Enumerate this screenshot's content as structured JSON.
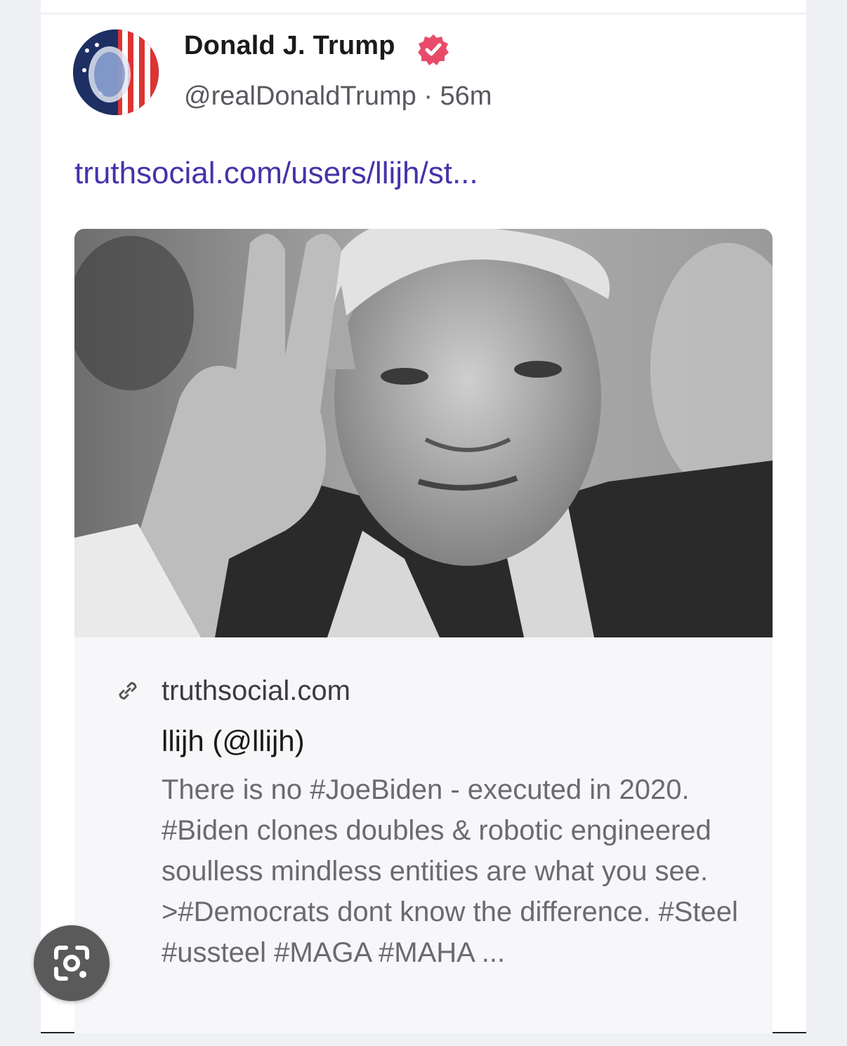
{
  "post": {
    "author_name": "Donald J. Trump",
    "handle": "@realDonaldTrump",
    "separator": "·",
    "time_ago": "56m",
    "link_text": "truthsocial.com/users/llijh/st..."
  },
  "preview": {
    "domain": "truthsocial.com",
    "title": "llijh (@llijh)",
    "description": "There is no #JoeBiden - executed in 2020. #Biden clones doubles & robotic engineered soulless mindless entities are what you see. >#Democrats dont know the difference. #Steel #ussteel #MAGA #MAHA ..."
  },
  "icons": {
    "verified": "verified-badge-icon",
    "link": "link-icon",
    "lens": "visual-search-icon"
  },
  "colors": {
    "link": "#4433aa",
    "verified": "#e84b6a"
  }
}
